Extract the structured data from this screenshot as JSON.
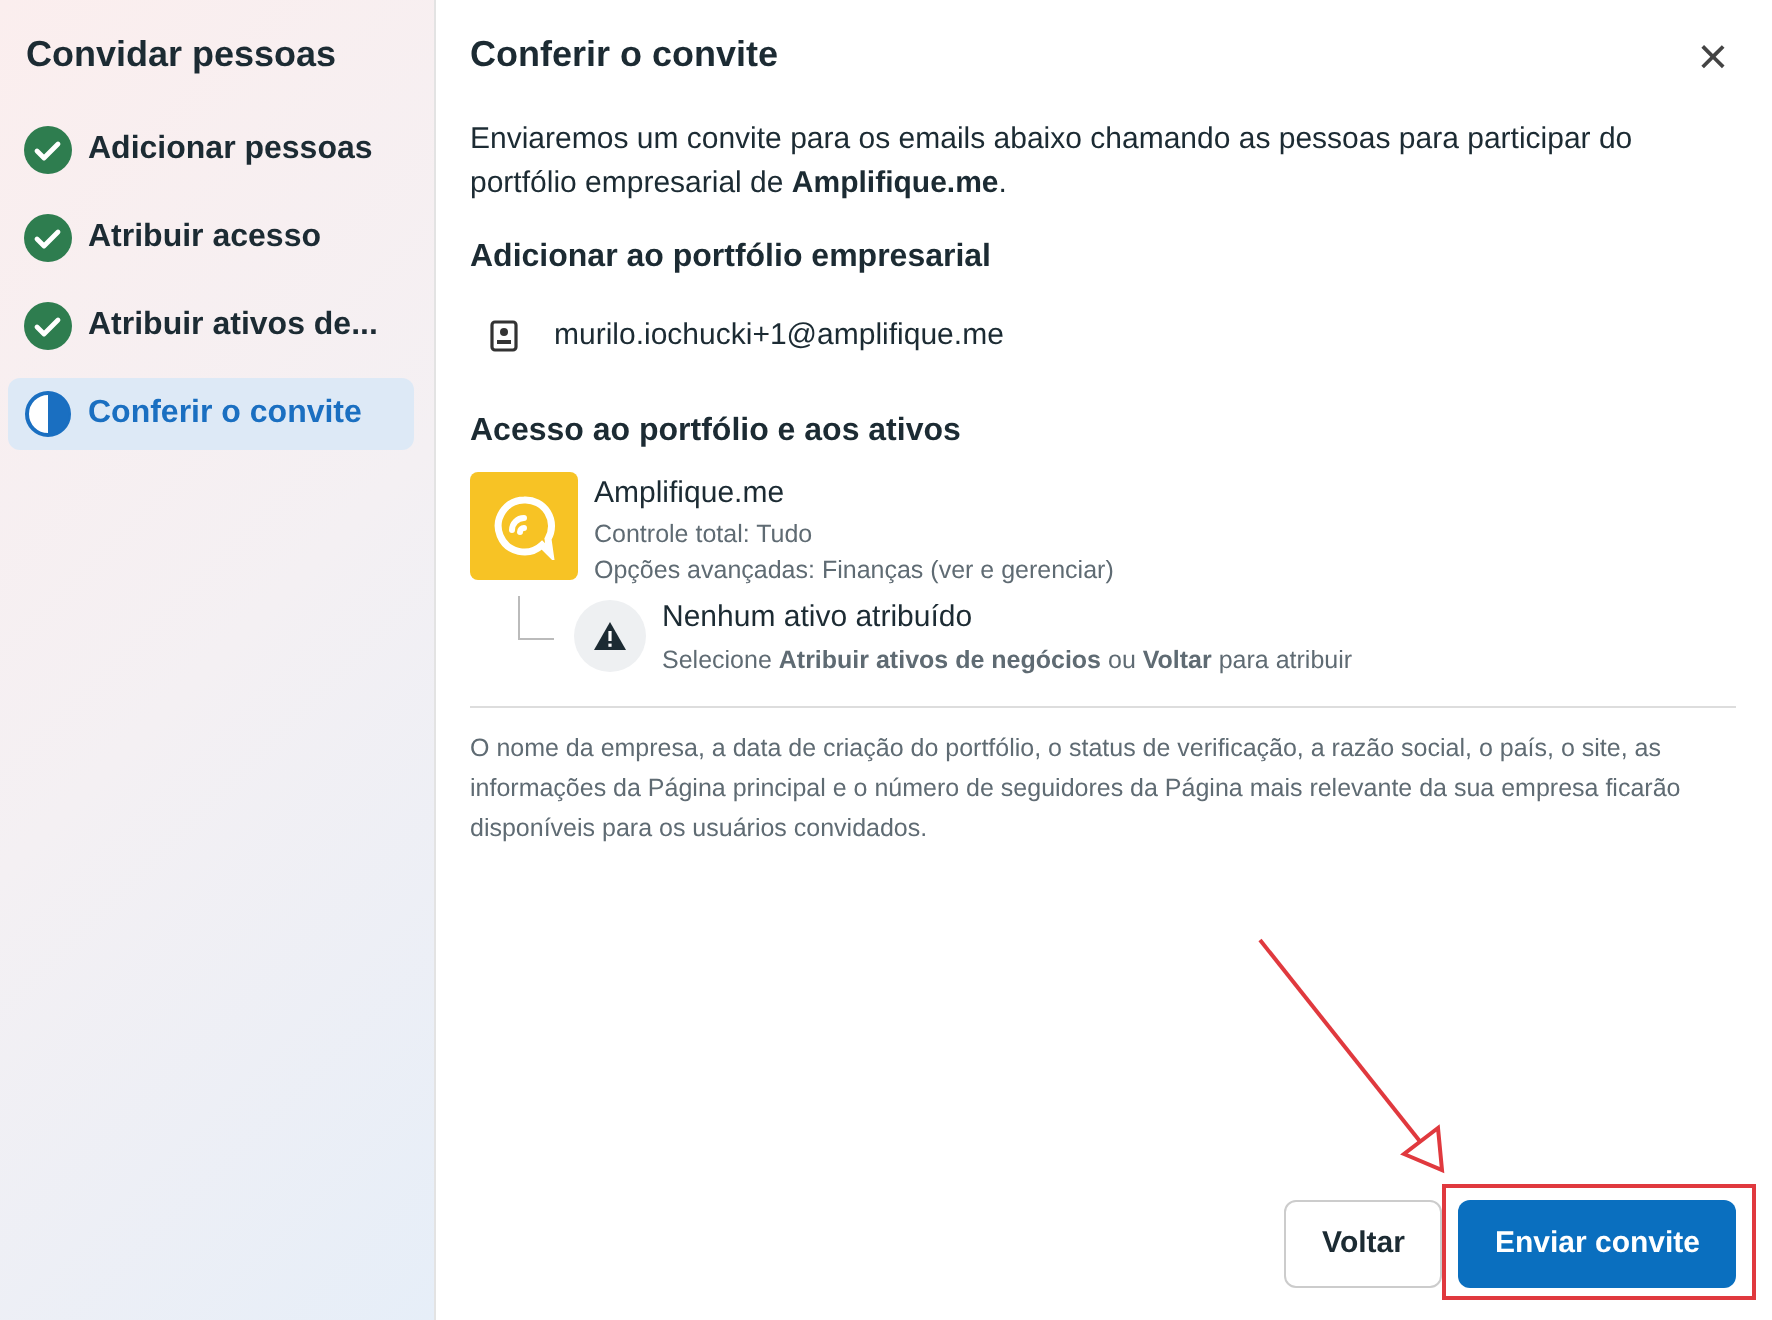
{
  "sidebar": {
    "title": "Convidar pessoas",
    "steps": [
      {
        "label": "Adicionar pessoas",
        "kind": "done",
        "selected": false
      },
      {
        "label": "Atribuir acesso",
        "kind": "done",
        "selected": false
      },
      {
        "label": "Atribuir ativos de...",
        "kind": "done",
        "selected": false
      },
      {
        "label": "Conferir o convite",
        "kind": "current",
        "selected": true
      }
    ]
  },
  "dialog": {
    "title": "Conferir o convite",
    "close": "×",
    "intro": "Enviaremos um convite para os emails abaixo chamando as pessoas para participar do portfólio empresarial de **Amplifique.me**.",
    "add_section": {
      "heading": "Adicionar ao portfólio empresarial",
      "emails": [
        "murilo.iochucki+1@amplifique.me"
      ]
    },
    "access_section": {
      "heading": "Acesso ao portfólio e aos ativos",
      "portfolio": {
        "name": "Amplifique.me",
        "details": [
          "Controle total: Tudo",
          "Opções avançadas: Finanças (ver e gerenciar)"
        ]
      },
      "assets": {
        "title": "Nenhum ativo atribuído",
        "hint": "Selecione **Atribuir ativos de negócios** ou **Voltar** para atribuir"
      }
    },
    "footnote": "O nome da empresa, a data de criação do portfólio, o status de verificação, a razão social, o país, o site, as informações da Página principal e o número de seguidores da Página mais relevante da sua empresa ficarão disponíveis para os usuários convidados.",
    "buttons": [
      {
        "label": "Voltar",
        "kind": "secondary"
      },
      {
        "label": "Enviar convite",
        "kind": "primary"
      }
    ]
  },
  "annotations": {
    "arrow": true,
    "highlight_frame": true
  }
}
